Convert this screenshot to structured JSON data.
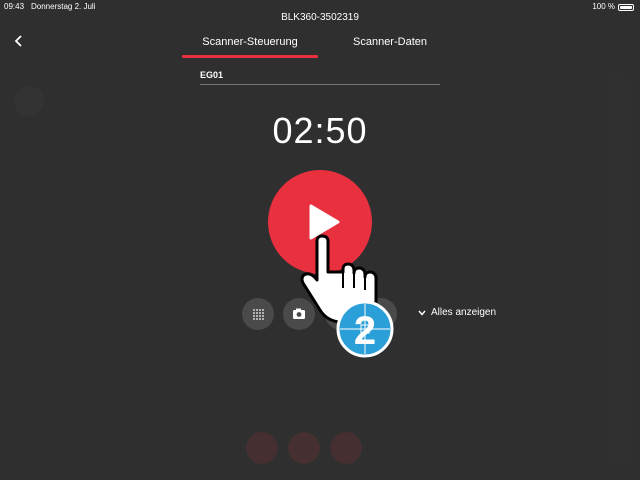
{
  "status_bar": {
    "time": "09:43",
    "date": "Donnerstag 2. Juli",
    "battery": "100 %"
  },
  "header": {
    "device_title": "BLK360-3502319"
  },
  "tabs": [
    {
      "label": "Scanner-Steuerung",
      "active": true
    },
    {
      "label": "Scanner-Daten",
      "active": false
    }
  ],
  "setup": {
    "name": "EG01"
  },
  "timer": "02:50",
  "options": {
    "show_all_label": "Alles anzeigen",
    "buttons": [
      "density-icon",
      "camera-icon",
      "hdr-icon",
      "lidar-icon"
    ]
  },
  "overlay": {
    "step_number": "2"
  },
  "colors": {
    "accent": "#e8303f",
    "background": "#2f2f2f",
    "badge": "#2a9fd8"
  }
}
